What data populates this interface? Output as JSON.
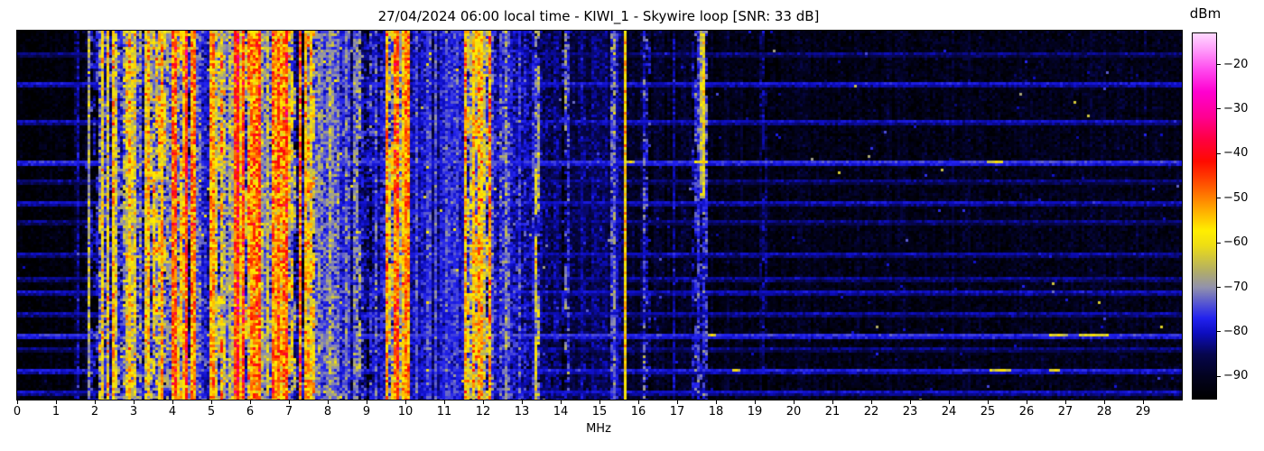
{
  "chart_data": {
    "type": "heatmap",
    "title": "27/04/2024 06:00 local time - KIWI_1 - Skywire loop [SNR: 33 dB]",
    "xlabel": "MHz",
    "x_range": [
      0,
      30
    ],
    "x_ticks": [
      0,
      1,
      2,
      3,
      4,
      5,
      6,
      7,
      8,
      9,
      10,
      11,
      12,
      13,
      14,
      15,
      16,
      17,
      18,
      19,
      20,
      21,
      22,
      23,
      24,
      25,
      26,
      27,
      28,
      29
    ],
    "y_ticks": [],
    "grid": false,
    "legend": "colorbar-right",
    "colorbar": {
      "label": "dBm",
      "ticks": [
        -20,
        -30,
        -40,
        -50,
        -60,
        -70,
        -80,
        -90
      ],
      "vmin": -95,
      "vmax": -13
    },
    "colormap_stops": [
      [
        0.0,
        "#000000"
      ],
      [
        0.06,
        "#02021e"
      ],
      [
        0.12,
        "#06064c"
      ],
      [
        0.18,
        "#0d0dc0"
      ],
      [
        0.22,
        "#2222ee"
      ],
      [
        0.26,
        "#5454d2"
      ],
      [
        0.305,
        "#9292ac"
      ],
      [
        0.35,
        "#b2ae66"
      ],
      [
        0.42,
        "#eede14"
      ],
      [
        0.46,
        "#ffee00"
      ],
      [
        0.51,
        "#ffb300"
      ],
      [
        0.555,
        "#ff7a00"
      ],
      [
        0.605,
        "#ff3c00"
      ],
      [
        0.65,
        "#ff0a00"
      ],
      [
        0.71,
        "#ff0041"
      ],
      [
        0.77,
        "#ff0090"
      ],
      [
        0.84,
        "#ff00d0"
      ],
      [
        0.9,
        "#ff49ee"
      ],
      [
        0.955,
        "#ff9cfa"
      ],
      [
        1.0,
        "#ffd9ff"
      ]
    ],
    "render": {
      "cols": 430,
      "rows": 137,
      "cell": 3,
      "seed": 1337
    },
    "bands": [
      {
        "f0": 0.0,
        "f1": 1.5,
        "base": -93,
        "col_jitter": 1,
        "cell_var": 2,
        "speck_prob": 0.002,
        "speck_level": -83
      },
      {
        "f0": 1.5,
        "f1": 1.82,
        "base": -87,
        "col_jitter": 3,
        "cell_var": 3,
        "gap_prob": 0.3,
        "gap_depth": 6,
        "speck_prob": 0.004,
        "speck_level": -72
      },
      {
        "f0": 1.82,
        "f1": 1.9,
        "base": -68,
        "col_jitter": 2,
        "cell_var": 5
      },
      {
        "f0": 1.9,
        "f1": 2.12,
        "base": -81,
        "col_jitter": 4,
        "cell_var": 4,
        "inter_prob": 0.3
      },
      {
        "f0": 2.12,
        "f1": 2.55,
        "base": -61,
        "col_jitter": 5,
        "cell_var": 6,
        "gap_prob": 0.25,
        "gap_depth": 18,
        "hot_prob": 0.1,
        "hot_boost": 5,
        "inter_prob": 0.4
      },
      {
        "f0": 2.55,
        "f1": 2.75,
        "base": -75,
        "col_jitter": 4,
        "cell_var": 5,
        "speck_prob": 0.01,
        "speck_level": -62
      },
      {
        "f0": 2.75,
        "f1": 3.05,
        "base": -59,
        "col_jitter": 5,
        "cell_var": 6,
        "gap_prob": 0.2,
        "gap_depth": 17,
        "hot_prob": 0.12,
        "hot_boost": 5,
        "inter_prob": 0.4
      },
      {
        "f0": 3.05,
        "f1": 3.2,
        "base": -73,
        "col_jitter": 4,
        "cell_var": 5,
        "inter_prob": 0.3
      },
      {
        "f0": 3.2,
        "f1": 3.85,
        "base": -56,
        "col_jitter": 5,
        "cell_var": 6,
        "gap_prob": 0.22,
        "gap_depth": 19,
        "hot_prob": 0.15,
        "hot_boost": 7,
        "inter_prob": 0.4
      },
      {
        "f0": 3.85,
        "f1": 4.0,
        "base": -71,
        "col_jitter": 4,
        "cell_var": 5
      },
      {
        "f0": 4.0,
        "f1": 4.6,
        "base": -58,
        "col_jitter": 5,
        "cell_var": 6,
        "gap_prob": 0.25,
        "gap_depth": 18,
        "hot_prob": 0.12,
        "hot_boost": 6,
        "inter_prob": 0.4
      },
      {
        "f0": 4.6,
        "f1": 4.95,
        "base": -76,
        "col_jitter": 4,
        "cell_var": 4,
        "speck_prob": 0.01,
        "speck_level": -63
      },
      {
        "f0": 4.95,
        "f1": 5.4,
        "base": -55,
        "col_jitter": 5,
        "cell_var": 6,
        "gap_prob": 0.2,
        "gap_depth": 20,
        "hot_prob": 0.15,
        "hot_boost": 7,
        "inter_prob": 0.35
      },
      {
        "f0": 5.4,
        "f1": 5.6,
        "base": -72,
        "col_jitter": 4,
        "cell_var": 5
      },
      {
        "f0": 5.6,
        "f1": 6.3,
        "base": -51,
        "col_jitter": 5,
        "cell_var": 6,
        "gap_prob": 0.18,
        "gap_depth": 23,
        "hot_prob": 0.2,
        "hot_boost": 6,
        "inter_prob": 0.3
      },
      {
        "f0": 6.3,
        "f1": 6.5,
        "base": -71,
        "col_jitter": 4,
        "cell_var": 5
      },
      {
        "f0": 6.5,
        "f1": 7.1,
        "base": -54,
        "col_jitter": 5,
        "cell_var": 6,
        "gap_prob": 0.2,
        "gap_depth": 20,
        "hot_prob": 0.15,
        "hot_boost": 6,
        "inter_prob": 0.35
      },
      {
        "f0": 7.1,
        "f1": 7.4,
        "base": -63,
        "col_jitter": 6,
        "cell_var": 6,
        "gap_prob": 0.3,
        "gap_depth": 12,
        "inter_prob": 0.4
      },
      {
        "f0": 7.4,
        "f1": 7.7,
        "base": -58,
        "col_jitter": 5,
        "cell_var": 6,
        "gap_prob": 0.25,
        "gap_depth": 16,
        "inter_prob": 0.35
      },
      {
        "f0": 7.7,
        "f1": 8.7,
        "base": -74,
        "col_jitter": 3,
        "cell_var": 4,
        "gap_prob": 0.15,
        "gap_depth": 8,
        "speck_prob": 0.012,
        "speck_level": -62
      },
      {
        "f0": 8.7,
        "f1": 9.15,
        "base": -70,
        "col_jitter": 5,
        "cell_var": 5,
        "gap_prob": 0.25,
        "gap_depth": 10,
        "hot_prob": 0.06,
        "hot_boost": 6,
        "inter_prob": 0.4
      },
      {
        "f0": 9.15,
        "f1": 9.5,
        "base": -79,
        "col_jitter": 3,
        "cell_var": 4
      },
      {
        "f0": 9.5,
        "f1": 10.0,
        "base": -58,
        "col_jitter": 5,
        "cell_var": 6,
        "gap_prob": 0.2,
        "gap_depth": 16,
        "hot_prob": 0.15,
        "hot_boost": 6,
        "inter_prob": 0.35
      },
      {
        "f0": 10.0,
        "f1": 10.15,
        "base": -50,
        "col_jitter": 3,
        "cell_var": 5
      },
      {
        "f0": 10.15,
        "f1": 11.5,
        "base": -77,
        "col_jitter": 2,
        "cell_var": 3,
        "gap_prob": 0.1,
        "gap_depth": 5,
        "speck_prob": 0.005,
        "speck_level": -61
      },
      {
        "f0": 11.5,
        "f1": 12.2,
        "base": -56,
        "col_jitter": 5,
        "cell_var": 6,
        "gap_prob": 0.2,
        "gap_depth": 18,
        "hot_prob": 0.13,
        "hot_boost": 6,
        "inter_prob": 0.35
      },
      {
        "f0": 12.2,
        "f1": 12.7,
        "base": -76,
        "col_jitter": 3,
        "cell_var": 4,
        "speck_prob": 0.006,
        "speck_level": -62
      },
      {
        "f0": 12.7,
        "f1": 13.3,
        "base": -82,
        "col_jitter": 3,
        "cell_var": 3.5,
        "speck_prob": 0.004,
        "speck_level": -68
      },
      {
        "f0": 13.3,
        "f1": 13.45,
        "base": -66,
        "col_jitter": 3,
        "cell_var": 5,
        "inter_prob": 0.5
      },
      {
        "f0": 13.45,
        "f1": 14.0,
        "base": -84,
        "col_jitter": 2.5,
        "cell_var": 3,
        "speck_prob": 0.004,
        "speck_level": -70
      },
      {
        "f0": 14.0,
        "f1": 14.25,
        "base": -76,
        "col_jitter": 4,
        "cell_var": 5,
        "gap_prob": 0.3,
        "gap_depth": 8,
        "inter_prob": 0.5
      },
      {
        "f0": 14.25,
        "f1": 15.25,
        "base": -86,
        "col_jitter": 2,
        "cell_var": 2.5,
        "speck_prob": 0.004,
        "speck_level": -74
      },
      {
        "f0": 15.25,
        "f1": 15.4,
        "base": -72,
        "col_jitter": 3,
        "cell_var": 5,
        "inter_prob": 0.6
      },
      {
        "f0": 15.4,
        "f1": 15.6,
        "base": -84,
        "col_jitter": 2,
        "cell_var": 3
      },
      {
        "f0": 15.6,
        "f1": 15.72,
        "base": -58,
        "col_jitter": 1.5,
        "cell_var": 4
      },
      {
        "f0": 15.72,
        "f1": 16.12,
        "base": -89,
        "col_jitter": 1.5,
        "cell_var": 2.5
      },
      {
        "f0": 16.12,
        "f1": 16.3,
        "base": -78,
        "col_jitter": 4,
        "cell_var": 5,
        "inter_prob": 0.6
      },
      {
        "f0": 16.3,
        "f1": 16.85,
        "base": -90,
        "col_jitter": 1.5,
        "cell_var": 2.5,
        "speck_prob": 0.003,
        "speck_level": -78
      },
      {
        "f0": 16.85,
        "f1": 16.98,
        "base": -84,
        "col_jitter": 2,
        "cell_var": 3,
        "inter_prob": 0.6
      },
      {
        "f0": 16.98,
        "f1": 17.4,
        "base": -90,
        "col_jitter": 1.5,
        "cell_var": 2.5,
        "speck_prob": 0.003,
        "speck_level": -78
      },
      {
        "f0": 17.4,
        "f1": 17.55,
        "base": -79,
        "col_jitter": 3,
        "cell_var": 4,
        "inter_prob": 0.4
      },
      {
        "f0": 17.55,
        "f1": 17.7,
        "base": -62,
        "col_jitter": 3,
        "cell_var": 5,
        "top_frac": 0.45,
        "base_lower": -80,
        "inter_prob": 0.5
      },
      {
        "f0": 17.7,
        "f1": 17.82,
        "base": -78,
        "col_jitter": 3,
        "cell_var": 4,
        "inter_prob": 0.3
      },
      {
        "f0": 17.82,
        "f1": 19.1,
        "base": -91,
        "col_jitter": 1.2,
        "cell_var": 2.2,
        "speck_prob": 0.003,
        "speck_level": -80
      },
      {
        "f0": 19.1,
        "f1": 19.3,
        "base": -85,
        "col_jitter": 2,
        "cell_var": 3,
        "inter_prob": 0.6
      },
      {
        "f0": 19.3,
        "f1": 30.0,
        "base": -91,
        "col_jitter": 1.2,
        "cell_var": 2.2,
        "speck_prob": 0.004,
        "speck_level": -80,
        "rare_prob": 0.0004,
        "rare_level": -65
      }
    ],
    "streaks": [
      {
        "frac": 0.059,
        "level": -83,
        "sparkle": false
      },
      {
        "frac": 0.139,
        "level": -79,
        "sparkle": false
      },
      {
        "frac": 0.244,
        "level": -80,
        "sparkle": false
      },
      {
        "frac": 0.355,
        "level": -76,
        "sparkle": true
      },
      {
        "frac": 0.408,
        "level": -83,
        "sparkle": false
      },
      {
        "frac": 0.46,
        "level": -80,
        "sparkle": false
      },
      {
        "frac": 0.518,
        "level": -83,
        "sparkle": false
      },
      {
        "frac": 0.601,
        "level": -81,
        "sparkle": false
      },
      {
        "frac": 0.67,
        "level": -82,
        "sparkle": false
      },
      {
        "frac": 0.704,
        "level": -80,
        "sparkle": false
      },
      {
        "frac": 0.768,
        "level": -81,
        "sparkle": false
      },
      {
        "frac": 0.824,
        "level": -76,
        "sparkle": true
      },
      {
        "frac": 0.863,
        "level": -83,
        "sparkle": false
      },
      {
        "frac": 0.919,
        "level": -78,
        "sparkle": true
      },
      {
        "frac": 0.976,
        "level": -80,
        "sparkle": false
      }
    ],
    "sparkle_level": -63
  }
}
